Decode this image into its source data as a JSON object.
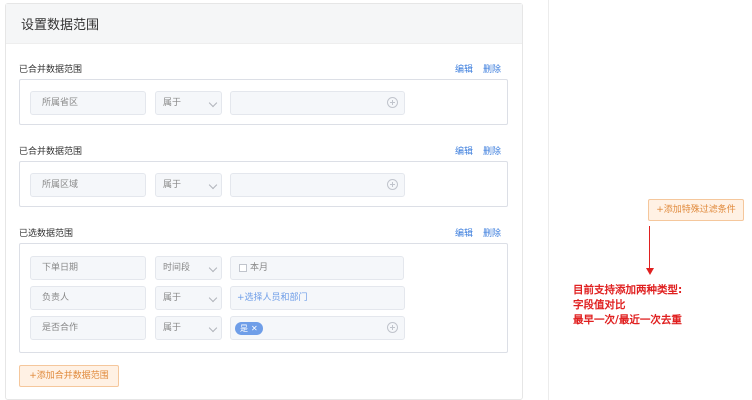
{
  "panel": {
    "title": "设置数据范围"
  },
  "sections": [
    {
      "title": "已合并数据范围",
      "edit": "编辑",
      "delete": "删除",
      "rows": [
        {
          "field": "所属省区",
          "op": "属于",
          "value": ""
        }
      ]
    },
    {
      "title": "已合并数据范围",
      "edit": "编辑",
      "delete": "删除",
      "rows": [
        {
          "field": "所属区域",
          "op": "属于",
          "value": ""
        }
      ]
    },
    {
      "title": "已选数据范围",
      "edit": "编辑",
      "delete": "删除",
      "rows": [
        {
          "field": "下单日期",
          "op": "时间段",
          "value": "本月"
        },
        {
          "field": "负责人",
          "op": "属于",
          "value": "+选择人员和部门"
        },
        {
          "field": "是否合作",
          "op": "属于",
          "value": "是"
        }
      ]
    }
  ],
  "add_merged_button": "+添加合并数据范围",
  "add_filter_button": "+添加特殊过滤条件",
  "annotation": {
    "lines": [
      "目前支持添加两种类型:",
      "字段值对比",
      "最早一次/最近一次去重"
    ],
    "color": "#e02020"
  },
  "colors": {
    "link": "#3b7ddd",
    "accent_orange": "#e08a3c",
    "tag": "#6f9ee8"
  }
}
